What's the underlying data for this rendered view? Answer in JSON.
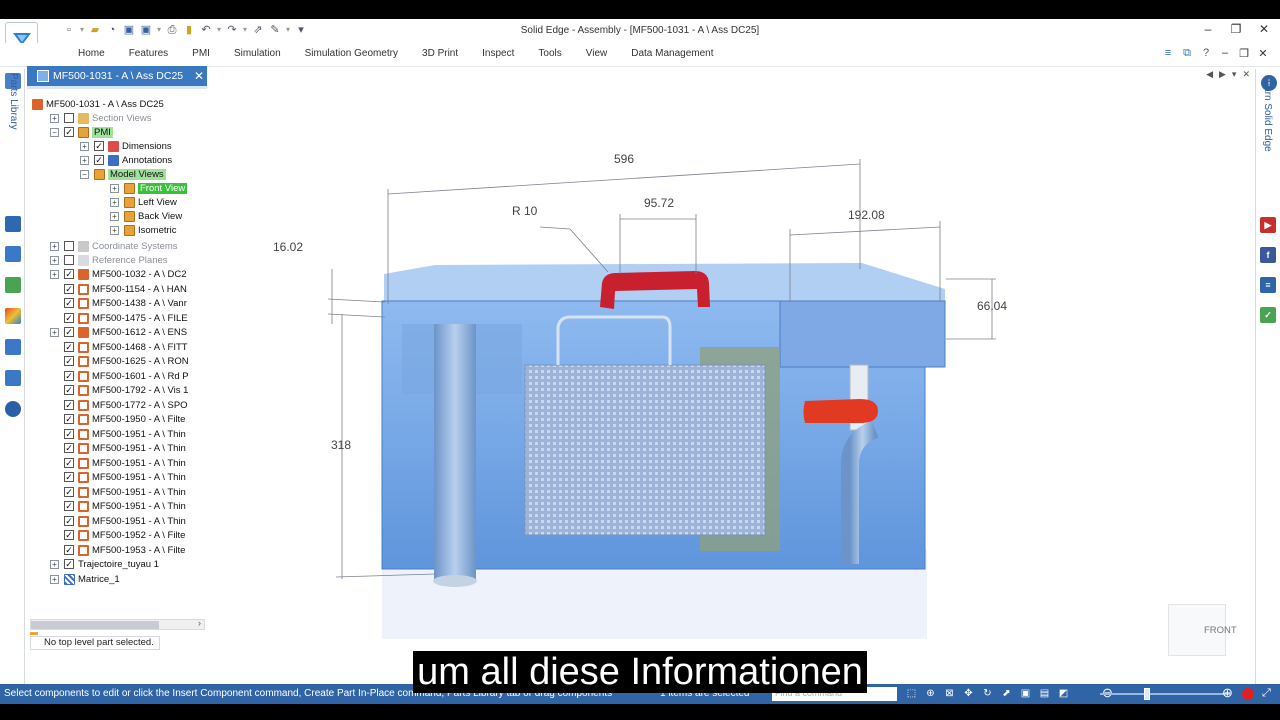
{
  "window": {
    "title": "Solid Edge - Assembly - [MF500-1031 - A \\ Ass DC25]",
    "controls": [
      "minimize",
      "restore",
      "close"
    ]
  },
  "ribbon": {
    "tabs": [
      "Home",
      "Features",
      "PMI",
      "Simulation",
      "Simulation Geometry",
      "3D Print",
      "Inspect",
      "Tools",
      "View",
      "Data Management"
    ]
  },
  "left_strip": {
    "parts_library_label": "Parts Library"
  },
  "right_strip": {
    "learn_label": "Learn Solid Edge",
    "icons": [
      "youtube-icon",
      "facebook-icon",
      "doc-icon",
      "chart-icon"
    ]
  },
  "document_tab": {
    "label": "MF500-1031 - A \\ Ass DC25"
  },
  "tree": {
    "root": "MF500-1031 - A \\ Ass DC25",
    "items": [
      {
        "label": "Section Views"
      },
      {
        "label": "PMI"
      },
      {
        "label": "Dimensions"
      },
      {
        "label": "Annotations"
      },
      {
        "label": "Model Views"
      },
      {
        "label": "Front View"
      },
      {
        "label": "Left View"
      },
      {
        "label": "Back View"
      },
      {
        "label": "Isometric"
      },
      {
        "label": "Coordinate Systems"
      },
      {
        "label": "Reference Planes"
      },
      {
        "label": "MF500-1032 - A \\ DC2"
      },
      {
        "label": "MF500-1154 - A \\ HAN"
      },
      {
        "label": "MF500-1438 - A \\ Vanr"
      },
      {
        "label": "MF500-1475 - A \\ FILE"
      },
      {
        "label": "MF500-1612 - A \\ ENS"
      },
      {
        "label": "MF500-1468 - A \\ FITT"
      },
      {
        "label": "MF500-1625 - A \\ RON"
      },
      {
        "label": "MF500-1601 - A \\ Rd P"
      },
      {
        "label": "MF500-1792 - A \\ Vis 1"
      },
      {
        "label": "MF500-1772 - A \\ SPO"
      },
      {
        "label": "MF500-1950 - A \\ Filte"
      },
      {
        "label": "MF500-1951 - A \\ Thin"
      },
      {
        "label": "MF500-1951 - A \\ Thin"
      },
      {
        "label": "MF500-1951 - A \\ Thin"
      },
      {
        "label": "MF500-1951 - A \\ Thin"
      },
      {
        "label": "MF500-1951 - A \\ Thin"
      },
      {
        "label": "MF500-1951 - A \\ Thin"
      },
      {
        "label": "MF500-1951 - A \\ Thin"
      },
      {
        "label": "MF500-1952 - A \\ Filte"
      },
      {
        "label": "MF500-1953 - A \\ Filte"
      },
      {
        "label": "Trajectoire_tuyau 1"
      },
      {
        "label": "Matrice_1"
      }
    ],
    "status": "No top level part selected."
  },
  "viewport": {
    "dimensions": {
      "overall_width": "596",
      "radius": "R 10",
      "handle_width": "95.72",
      "right_section": "192.08",
      "top_offset": "16.02",
      "right_height": "66.04",
      "height": "318"
    },
    "view_cube": "FRONT",
    "colors": {
      "tank_blue": "#6a9fe0",
      "handle_red": "#c8202e",
      "valve_red": "#e23a22",
      "basket_gray": "#a8b8cf"
    }
  },
  "statusbar": {
    "prompt": "Select components to edit or click the Insert Component command, Create Part In-Place command, Parts Library tab or drag components",
    "selection": "1 items are selected",
    "find_placeholder": "Find a command"
  },
  "subtitle": "um all diese Informationen"
}
